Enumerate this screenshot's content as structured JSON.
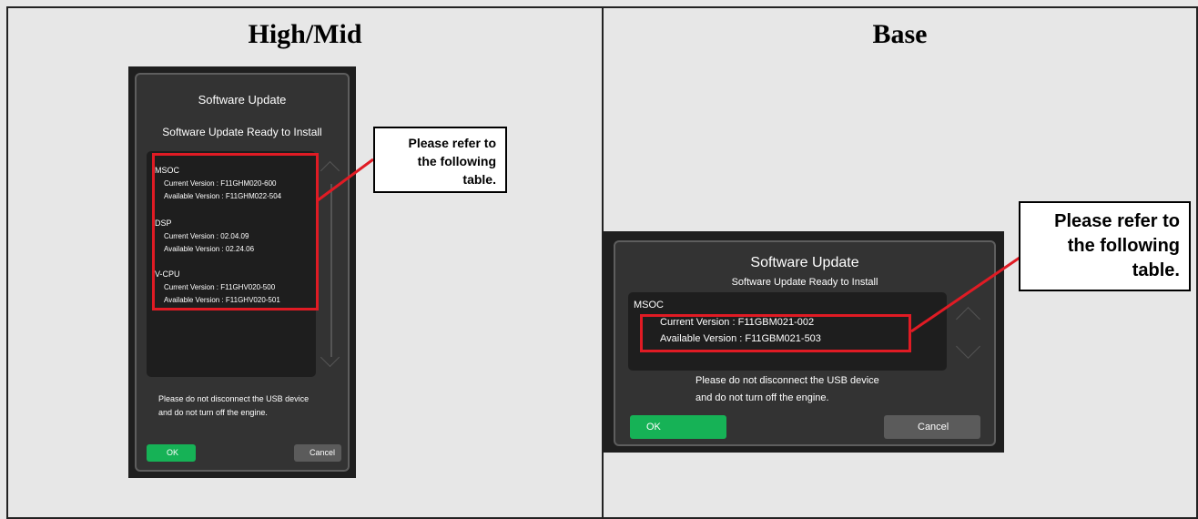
{
  "panels": {
    "left_title": "High/Mid",
    "right_title": "Base"
  },
  "left_screen": {
    "title": "Software Update",
    "subtitle": "Software Update Ready to Install",
    "items": [
      {
        "name": "MSOC",
        "current": "Current Version  : F11GHM020-600",
        "available": "Available Version : F11GHM022-504"
      },
      {
        "name": "DSP",
        "current": "Current Version  : 02.04.09",
        "available": "Available Version : 02.24.06"
      },
      {
        "name": "V-CPU",
        "current": "Current Version  : F11GHV020-500",
        "available": "Available Version : F11GHV020-501"
      }
    ],
    "warning_line1": "Please do not disconnect the USB device",
    "warning_line2": "and do not turn off the engine.",
    "ok_label": "OK",
    "cancel_label": "Cancel"
  },
  "right_screen": {
    "title": "Software Update",
    "subtitle": "Software Update Ready to Install",
    "item_name": "MSOC",
    "current": "Current Version    : F11GBM021-002",
    "available": "Available Version  : F11GBM021-503",
    "warning_line1": "Please do not disconnect the USB device",
    "warning_line2": "and do not turn off the engine.",
    "ok_label": "OK",
    "cancel_label": "Cancel"
  },
  "callouts": {
    "left_line1": "Please refer to",
    "left_line2": "the following",
    "left_line3": "table.",
    "right_line1": "Please refer to",
    "right_line2": "the following",
    "right_line3": "table."
  },
  "colors": {
    "highlight": "#e01b24",
    "ok_button": "#16b256",
    "cancel_button": "#5b5b5b"
  }
}
